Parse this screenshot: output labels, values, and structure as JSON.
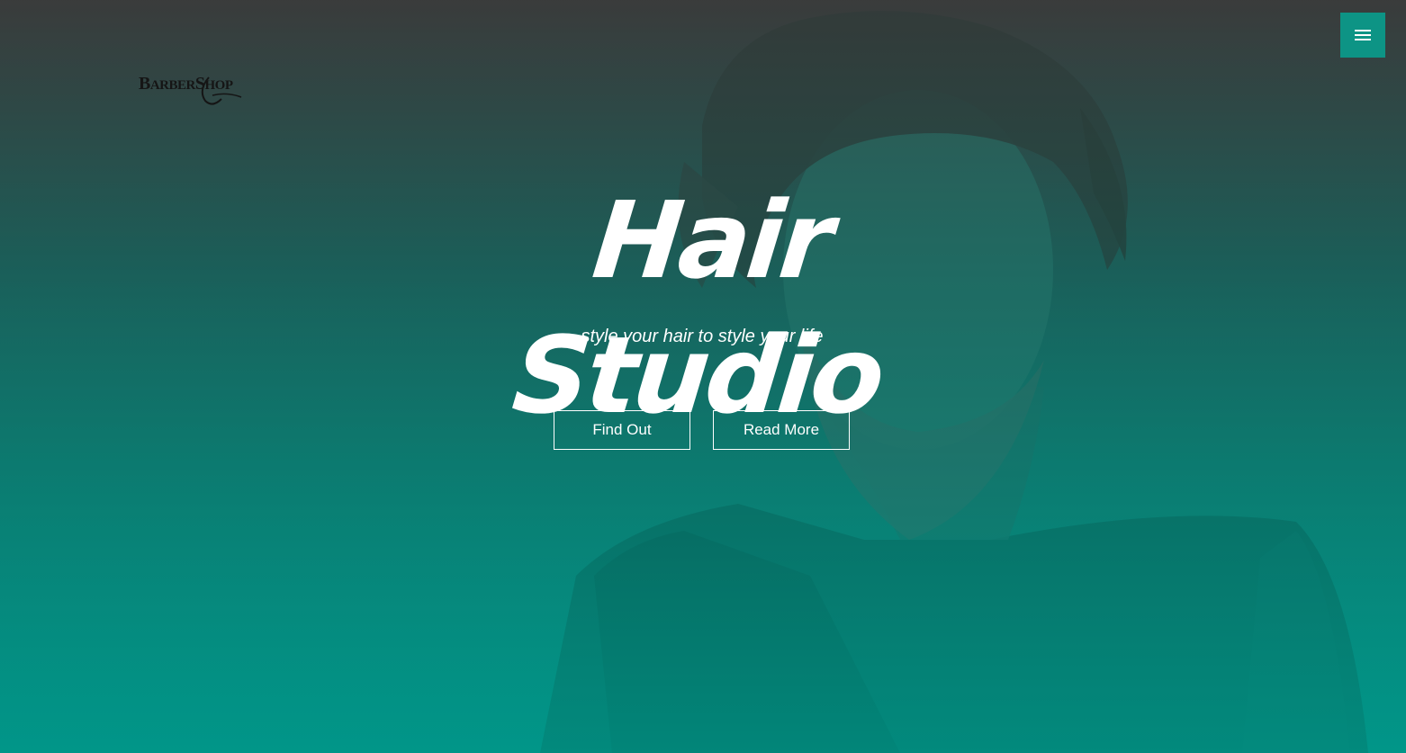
{
  "header": {
    "logo": {
      "text_big": "B",
      "text_rest1": "ARBER",
      "text_big2": "S",
      "text_rest2": "HOP"
    },
    "menu_icon": "hamburger-icon"
  },
  "hero": {
    "title": "Hair Studio",
    "subtitle": "style your hair to style your life",
    "buttons": {
      "find_out": "Find Out",
      "read_more": "Read More"
    }
  },
  "colors": {
    "accent": "#0d9485",
    "overlay_top": "#3d3d3d",
    "overlay_bottom": "#03958a",
    "text": "#ffffff"
  }
}
